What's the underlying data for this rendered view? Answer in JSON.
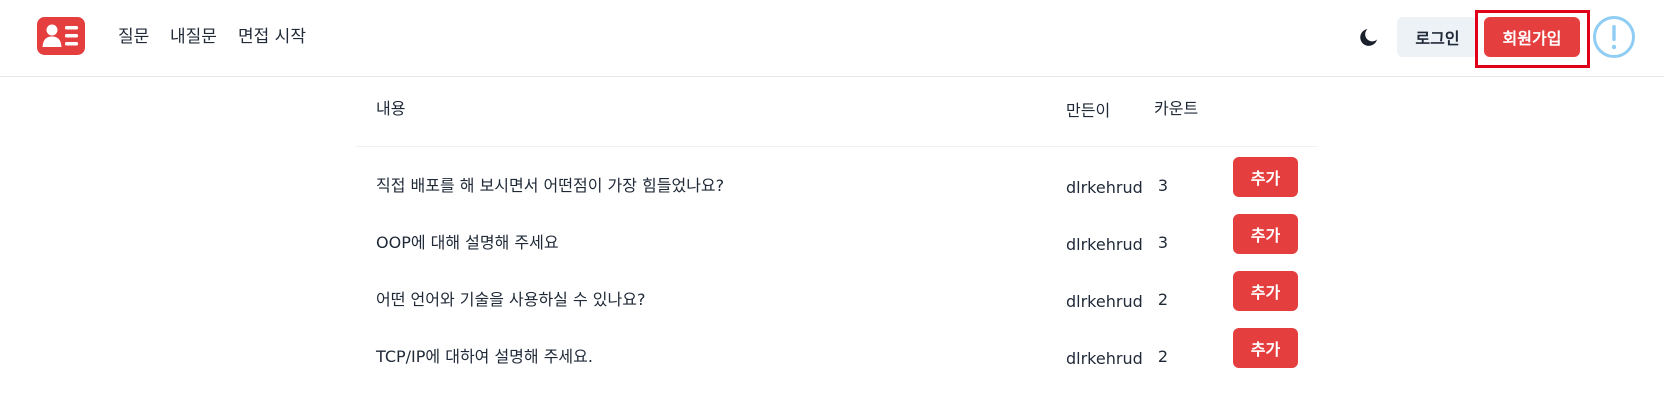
{
  "nav": {
    "links": [
      "질문",
      "내질문",
      "면접 시작"
    ],
    "login_label": "로그인",
    "signup_label": "회원가입",
    "icons": {
      "logo": "id-card-icon",
      "theme": "moon-icon",
      "alert": "exclamation-circle-icon"
    },
    "colors": {
      "brand": "#e53e3e",
      "alert_outline": "#90cdf4",
      "highlight": "#e0001a"
    }
  },
  "table": {
    "headers": {
      "content": "내용",
      "creator": "만든이",
      "count": "카운트"
    },
    "add_label": "추가",
    "rows": [
      {
        "content": "직접 배포를 해 보시면서 어떤점이 가장 힘들었나요?",
        "creator": "dlrkehrud",
        "count": "3"
      },
      {
        "content": "OOP에 대해 설명해 주세요",
        "creator": "dlrkehrud",
        "count": "3"
      },
      {
        "content": "어떤 언어와 기술을 사용하실 수 있나요?",
        "creator": "dlrkehrud",
        "count": "2"
      },
      {
        "content": "TCP/IP에 대하여 설명해 주세요.",
        "creator": "dlrkehrud",
        "count": "2"
      }
    ]
  }
}
